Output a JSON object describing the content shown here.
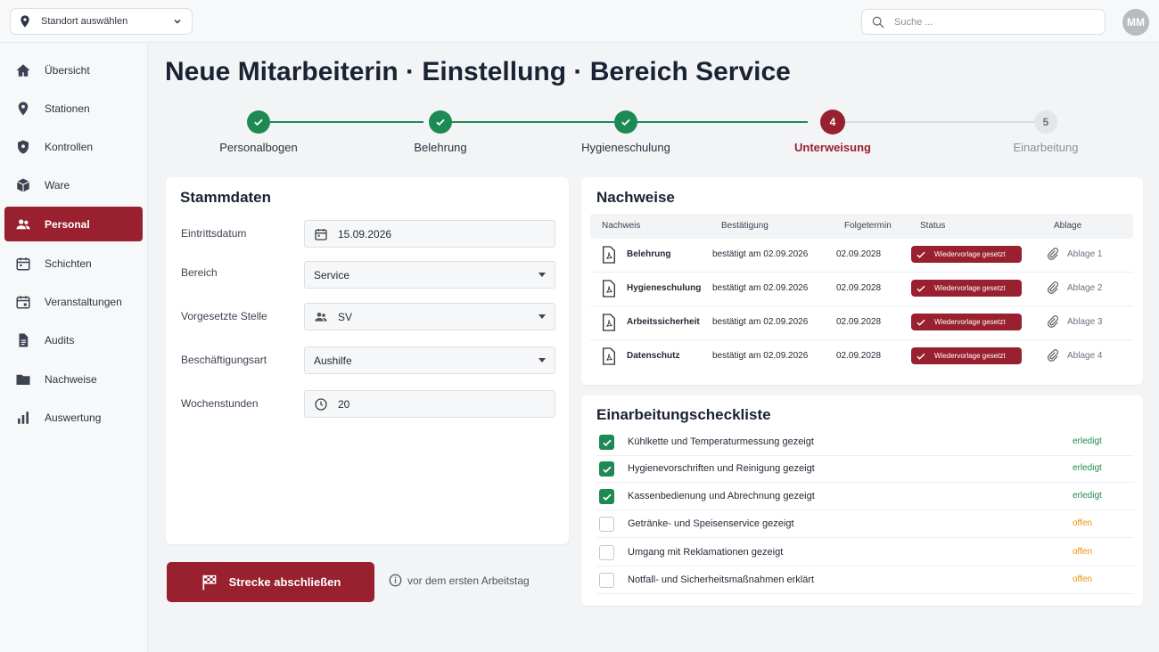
{
  "header": {
    "location_label": "Standort auswählen",
    "search_placeholder": "Suche ...",
    "avatar_initials": "MM"
  },
  "sidebar": {
    "items": [
      {
        "label": "Übersicht",
        "icon": "home-icon",
        "active": false
      },
      {
        "label": "Stationen",
        "icon": "location-pin-icon",
        "active": false
      },
      {
        "label": "Kontrollen",
        "icon": "shield-icon",
        "active": false
      },
      {
        "label": "Ware",
        "icon": "box-icon",
        "active": false
      },
      {
        "label": "Personal",
        "icon": "people-icon",
        "active": true
      },
      {
        "label": "Schichten",
        "icon": "calendar-icon",
        "active": false
      },
      {
        "label": "Veranstaltungen",
        "icon": "calendar-event-icon",
        "active": false
      },
      {
        "label": "Audits",
        "icon": "document-icon",
        "active": false
      },
      {
        "label": "Nachweise",
        "icon": "folder-icon",
        "active": false
      },
      {
        "label": "Auswertung",
        "icon": "bar-chart-icon",
        "active": false
      }
    ]
  },
  "page": {
    "title": "Neue Mitarbeiterin · Einstellung · Bereich Service"
  },
  "stepper": {
    "steps": [
      {
        "label": "Personalbogen",
        "state": "done",
        "number": ""
      },
      {
        "label": "Belehrung",
        "state": "done",
        "number": ""
      },
      {
        "label": "Hygieneschulung",
        "state": "done",
        "number": ""
      },
      {
        "label": "Unterweisung",
        "state": "current",
        "number": "4"
      },
      {
        "label": "Einarbeitung",
        "state": "todo",
        "number": "5"
      }
    ]
  },
  "stammdaten": {
    "title": "Stammdaten",
    "fields": [
      {
        "label": "Eintrittsdatum",
        "value": "15.09.2026",
        "icon": "calendar-icon",
        "type": "date"
      },
      {
        "label": "Bereich",
        "value": "Service",
        "icon": "",
        "type": "select"
      },
      {
        "label": "Vorgesetzte Stelle",
        "value": "SV",
        "icon": "people-icon",
        "type": "select"
      },
      {
        "label": "Beschäftigungsart",
        "value": "Aushilfe",
        "icon": "",
        "type": "select"
      },
      {
        "label": "Wochenstunden",
        "value": "20",
        "icon": "clock-icon",
        "type": "number"
      }
    ]
  },
  "nachweise": {
    "title": "Nachweise",
    "columns": [
      "Nachweis",
      "Bestätigung",
      "Folgetermin",
      "Status",
      "Ablage"
    ],
    "rows": [
      {
        "name": "Belehrung",
        "confirmation": "bestätigt am 02.09.2026",
        "next": "02.09.2028",
        "status": "Wiedervorlage gesetzt",
        "file": "Ablage 1"
      },
      {
        "name": "Hygieneschulung",
        "confirmation": "bestätigt am 02.09.2026",
        "next": "02.09.2028",
        "status": "Wiedervorlage gesetzt",
        "file": "Ablage 2"
      },
      {
        "name": "Arbeitssicherheit",
        "confirmation": "bestätigt am 02.09.2026",
        "next": "02.09.2028",
        "status": "Wiedervorlage gesetzt",
        "file": "Ablage 3"
      },
      {
        "name": "Datenschutz",
        "confirmation": "bestätigt am 02.09.2026",
        "next": "02.09.2028",
        "status": "Wiedervorlage gesetzt",
        "file": "Ablage 4"
      }
    ]
  },
  "checklist": {
    "title": "Einarbeitungscheckliste",
    "items": [
      {
        "text": "Kühlkette und Temperaturmessung gezeigt",
        "state": "erledigt",
        "checked": true
      },
      {
        "text": "Hygienevorschriften und Reinigung gezeigt",
        "state": "erledigt",
        "checked": true
      },
      {
        "text": "Kassenbedienung und Abrechnung gezeigt",
        "state": "erledigt",
        "checked": true
      },
      {
        "text": "Getränke- und Speisenservice gezeigt",
        "state": "offen",
        "checked": false
      },
      {
        "text": "Umgang mit Reklamationen gezeigt",
        "state": "offen",
        "checked": false
      },
      {
        "text": "Notfall- und Sicherheitsmaßnahmen erklärt",
        "state": "offen",
        "checked": false
      }
    ]
  },
  "actions": {
    "finish_label": "Strecke abschließen",
    "hint": "vor dem ersten Arbeitstag"
  },
  "colors": {
    "brand": "#98202f",
    "success": "#1e8a53",
    "warning": "#e59406"
  }
}
